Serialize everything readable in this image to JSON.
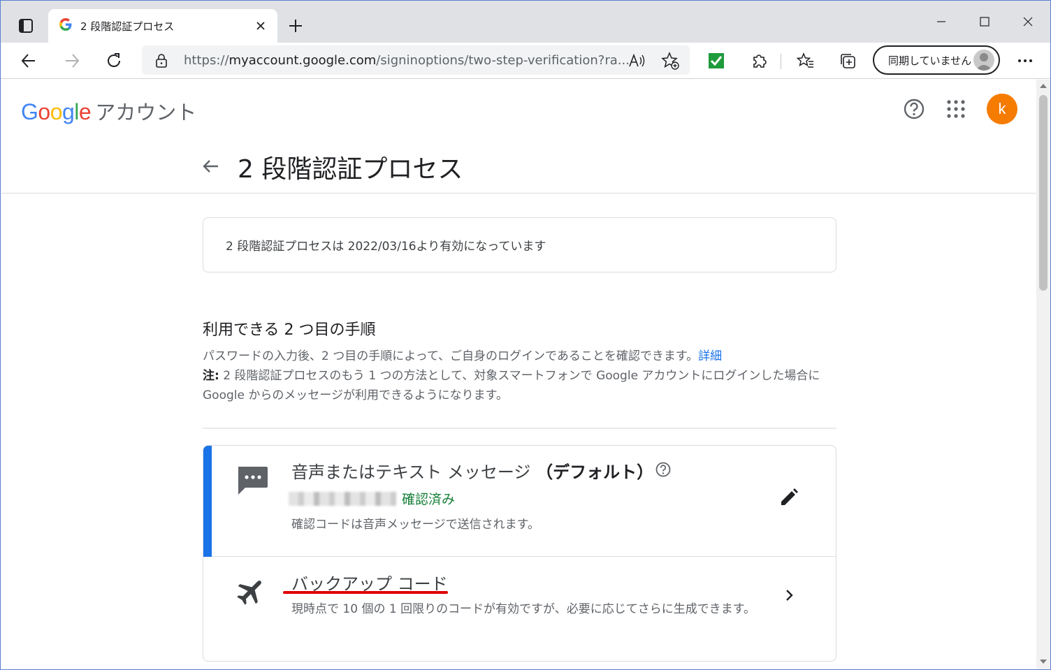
{
  "browser": {
    "tab_title": "2 段階認証プロセス",
    "url_prefix": "https://",
    "url_host": "myaccount.google.com",
    "url_path": "/signinoptions/two-step-verification?ra...",
    "profile_label": "同期していません"
  },
  "header": {
    "logo_letters": [
      {
        "ch": "G",
        "color": "#4285F4"
      },
      {
        "ch": "o",
        "color": "#EA4335"
      },
      {
        "ch": "o",
        "color": "#FBBC05"
      },
      {
        "ch": "g",
        "color": "#4285F4"
      },
      {
        "ch": "l",
        "color": "#34A853"
      },
      {
        "ch": "e",
        "color": "#EA4335"
      }
    ],
    "logo_suffix": "アカウント",
    "avatar_initial": "k",
    "avatar_color": "#F57C00"
  },
  "page": {
    "title": "2 段階認証プロセス",
    "status_text": "2 段階認証プロセスは 2022/03/16より有効になっています",
    "section_title": "利用できる 2 つ目の手順",
    "section_desc": "パスワードの入力後、2 つ目の手順によって、ご自身のログインであることを確認できます。",
    "details_link": "詳細",
    "note_label": "注:",
    "note_text": " 2 段階認証プロセスのもう 1 つの方法として、対象スマートフォンで Google アカウントにログインした場合に Google からのメッセージが利用できるようになります。"
  },
  "methods": {
    "sms": {
      "title": "音声またはテキスト メッセージ",
      "default_label": "（デフォルト）",
      "verified_label": "確認済み",
      "description": "確認コードは音声メッセージで送信されます。",
      "accent_color": "#1A73E8"
    },
    "backup": {
      "title": "バックアップ コード",
      "description": "現時点で 10 個の 1 回限りのコードが有効ですが、必要に応じてさらに生成できます。",
      "highlight_color": "#E00000"
    }
  }
}
